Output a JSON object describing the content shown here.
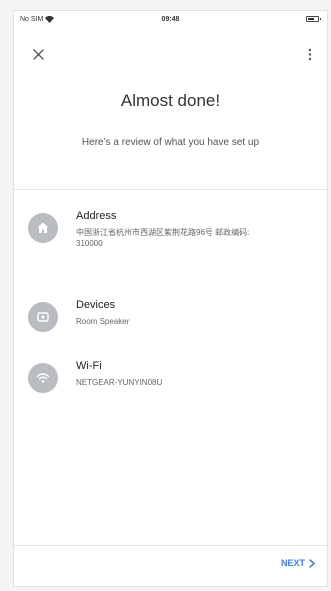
{
  "status_bar": {
    "carrier": "No SIM",
    "time": "09:48"
  },
  "header": {
    "title": "Almost done!",
    "subtitle": "Here’s a review of what you have set up"
  },
  "items": [
    {
      "icon": "home-icon",
      "title": "Address",
      "subtitle": "中国浙江省杭州市西湖区紫荆花路96号 邮政编码: 310000"
    },
    {
      "icon": "speaker-icon",
      "title": "Devices",
      "subtitle": "Room Speaker"
    },
    {
      "icon": "wifi-icon",
      "title": "Wi-Fi",
      "subtitle": "NETGEAR-YUNYIN08U"
    }
  ],
  "footer": {
    "next_label": "NEXT"
  },
  "colors": {
    "accent": "#3f7fe0",
    "icon_bg": "#b9bcc1"
  }
}
